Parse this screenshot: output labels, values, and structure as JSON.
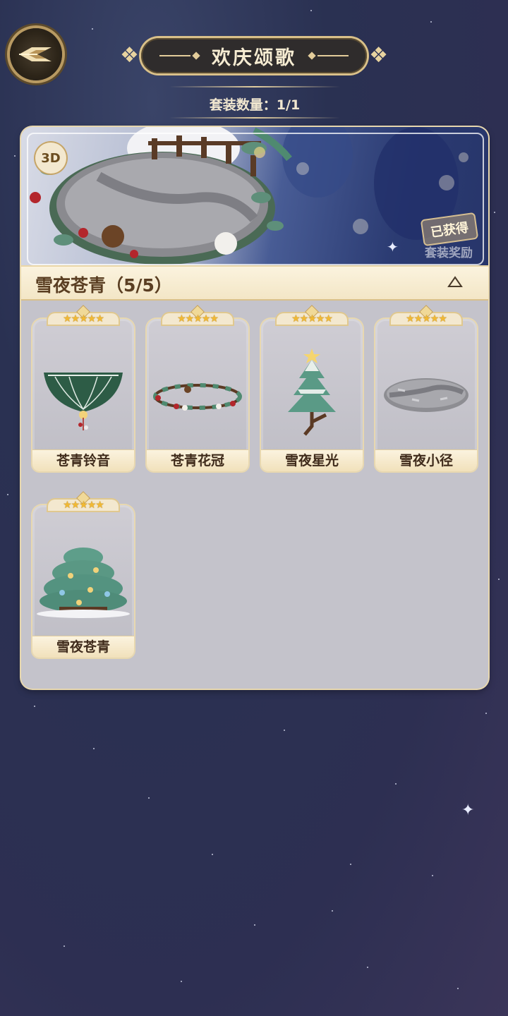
{
  "header": {
    "title": "欢庆颂歌",
    "set_count_label": "套装数量：1/1"
  },
  "banner": {
    "badge_3d": "3D",
    "obtained_stamp": "已获得",
    "reward_label": "套装奖励"
  },
  "set": {
    "name": "雪夜苍青（5/5）",
    "expanded": true
  },
  "items": [
    {
      "name": "苍青铃音",
      "stars": "★★★★★",
      "icon": "bell-canopy-icon"
    },
    {
      "name": "苍青花冠",
      "stars": "★★★★★",
      "icon": "wreath-icon"
    },
    {
      "name": "雪夜星光",
      "stars": "★★★★★",
      "icon": "star-tree-icon"
    },
    {
      "name": "雪夜小径",
      "stars": "★★★★★",
      "icon": "stone-path-icon"
    },
    {
      "name": "雪夜苍青",
      "stars": "★★★★★",
      "icon": "large-tree-icon"
    }
  ],
  "colors": {
    "accent_gold": "#e3cc9a",
    "panel_bg": "#c4c3cb",
    "label_text": "#3f2b1b",
    "star_gold": "#f1b934"
  }
}
